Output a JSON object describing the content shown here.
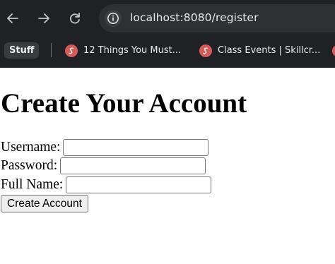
{
  "browser": {
    "url": "localhost:8080/register",
    "bookmarks": {
      "folder": "Stuff",
      "items": [
        {
          "label": "12 Things You Must..."
        },
        {
          "label": "Class Events | Skillcr..."
        },
        {
          "label": ""
        }
      ]
    },
    "icons": {
      "back": "back-arrow-icon",
      "forward": "forward-arrow-icon",
      "reload": "reload-icon",
      "site_info": "info-icon",
      "favicon": "skillcrush-favicon-icon"
    },
    "colors": {
      "chrome_bg": "#202124",
      "omnibox_bg": "#2f3033",
      "favicon": "#d75a5a"
    }
  },
  "page": {
    "title": "Create Your Account",
    "form": {
      "username_label": "Username:",
      "username_value": "",
      "password_label": "Password:",
      "password_value": "",
      "fullname_label": "Full Name:",
      "fullname_value": "",
      "submit_label": "Create Account"
    }
  }
}
